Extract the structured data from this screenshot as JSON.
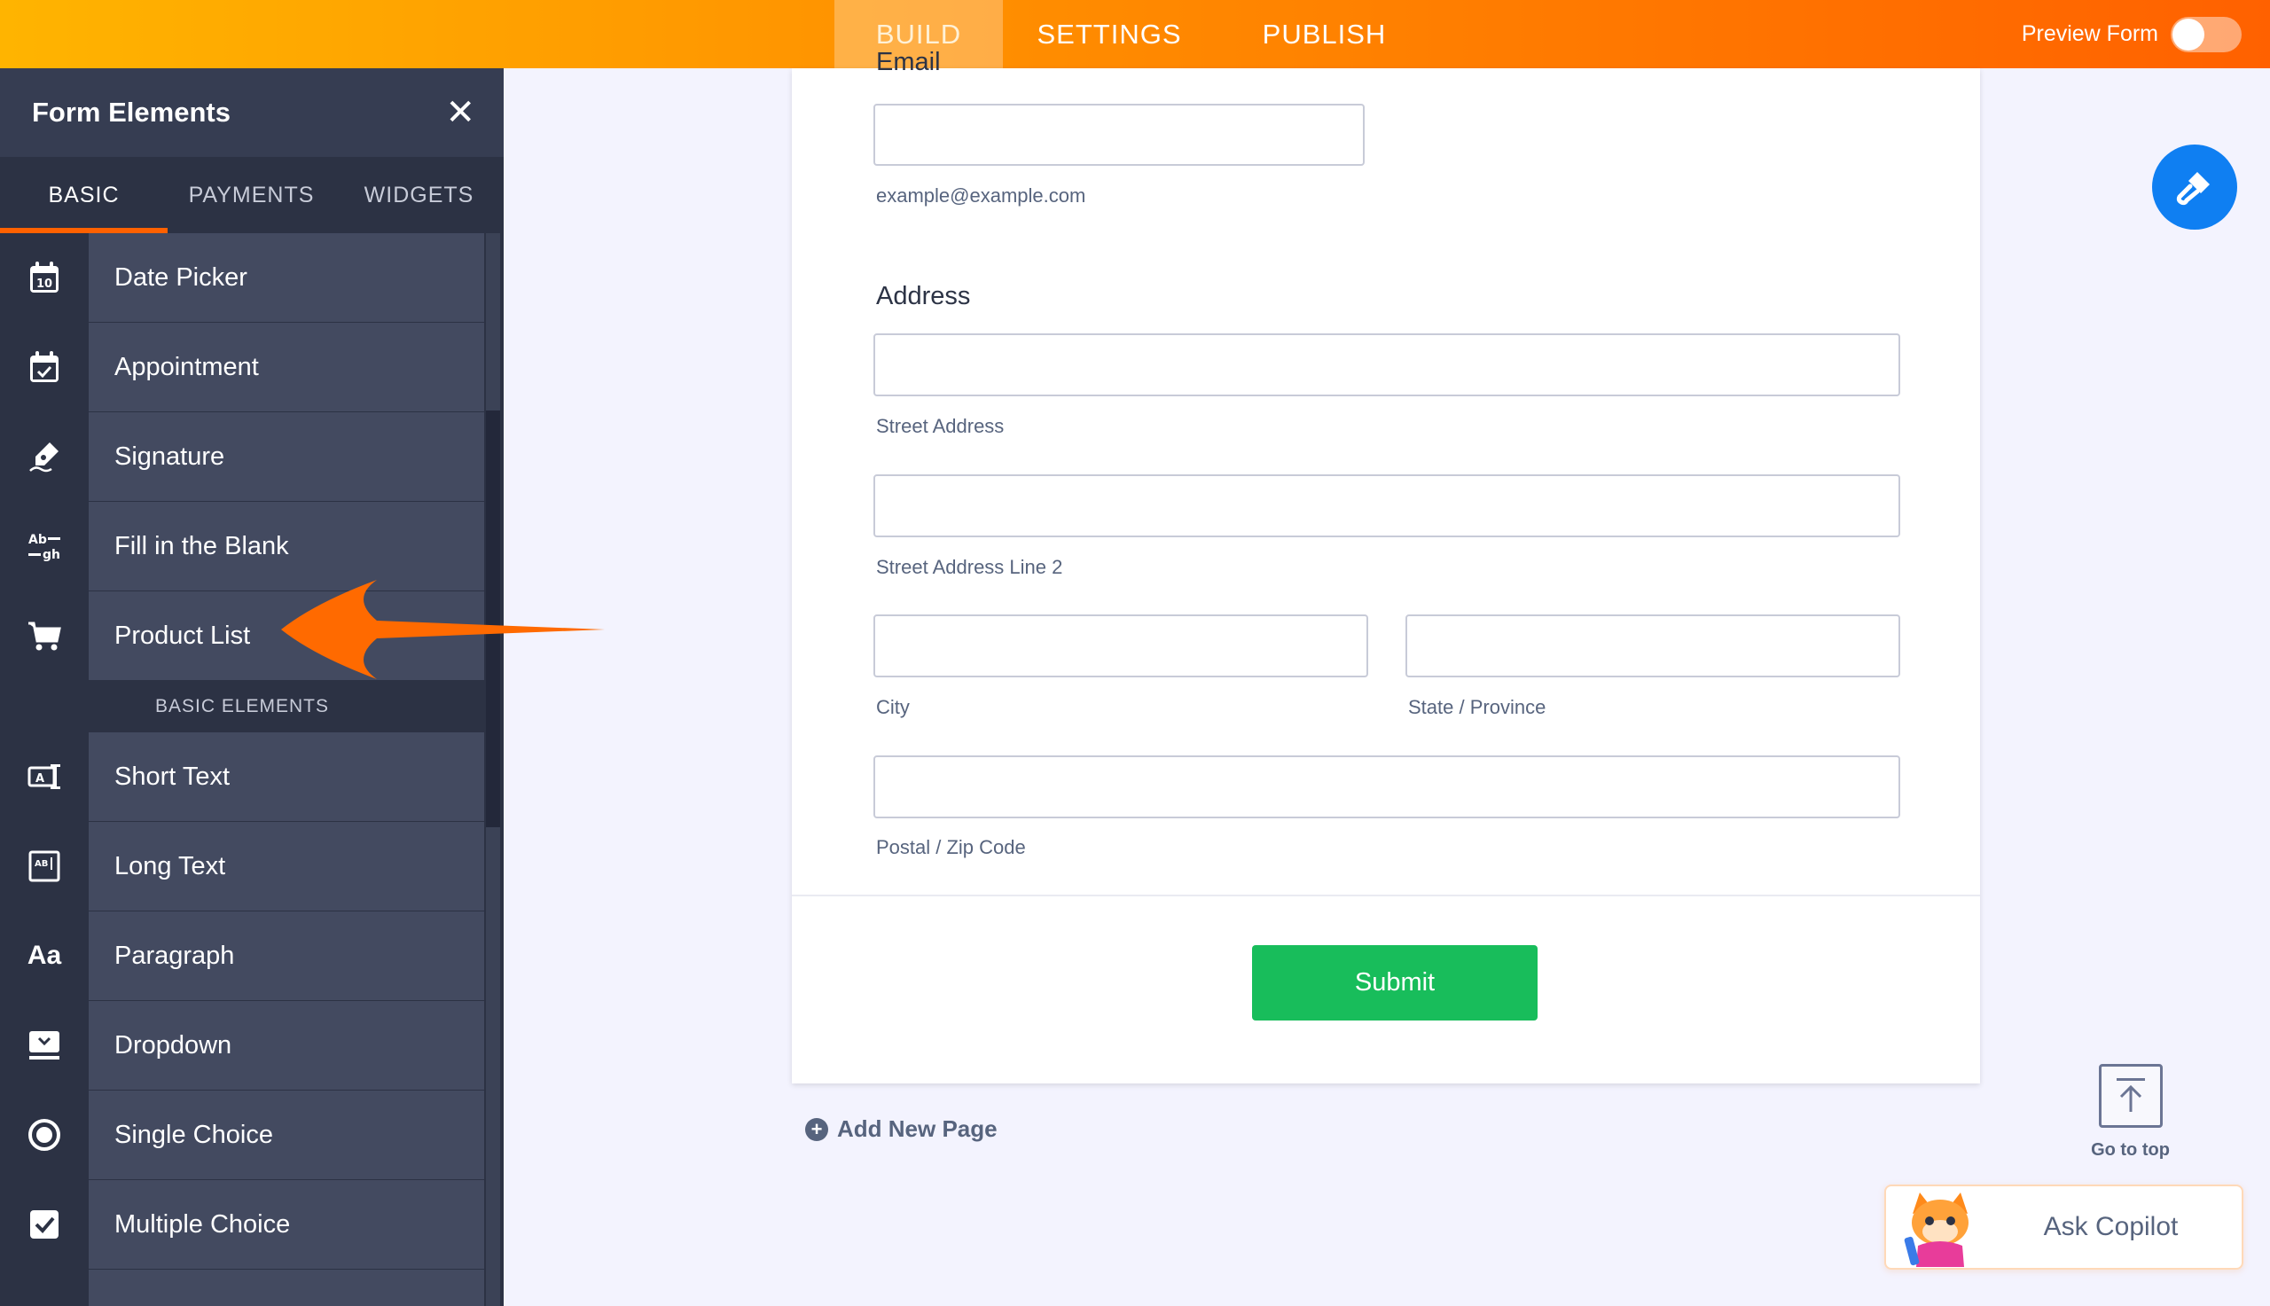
{
  "topbar": {
    "tabs": [
      {
        "label": "BUILD",
        "active": true
      },
      {
        "label": "SETTINGS",
        "active": false
      },
      {
        "label": "PUBLISH",
        "active": false
      }
    ],
    "preview_label": "Preview Form",
    "preview_enabled": false
  },
  "sidebar": {
    "title": "Form Elements",
    "tabs": [
      "BASIC",
      "PAYMENTS",
      "WIDGETS"
    ],
    "active_tab": "BASIC",
    "items_top": [
      {
        "label": "Date Picker",
        "icon": "calendar-icon"
      },
      {
        "label": "Appointment",
        "icon": "calendar-check-icon"
      },
      {
        "label": "Signature",
        "icon": "pen-icon"
      },
      {
        "label": "Fill in the Blank",
        "icon": "fill-blank-icon"
      },
      {
        "label": "Product List",
        "icon": "cart-icon"
      }
    ],
    "section_label": "BASIC ELEMENTS",
    "items_basic": [
      {
        "label": "Short Text",
        "icon": "short-text-icon"
      },
      {
        "label": "Long Text",
        "icon": "long-text-icon"
      },
      {
        "label": "Paragraph",
        "icon": "paragraph-icon"
      },
      {
        "label": "Dropdown",
        "icon": "dropdown-icon"
      },
      {
        "label": "Single Choice",
        "icon": "radio-icon"
      },
      {
        "label": "Multiple Choice",
        "icon": "checkbox-icon"
      }
    ],
    "paragraph_glyph": "Aa",
    "fill_blank_glyph_top": "Ab",
    "fill_blank_glyph_bottom": "gh"
  },
  "form": {
    "email_label": "Email",
    "email_sublabel": "example@example.com",
    "address_label": "Address",
    "street_sublabel": "Street Address",
    "street2_sublabel": "Street Address Line 2",
    "city_sublabel": "City",
    "state_sublabel": "State / Province",
    "postal_sublabel": "Postal / Zip Code",
    "submit_label": "Submit"
  },
  "add_page_label": "Add New Page",
  "go_to_top_label": "Go to top",
  "copilot_label": "Ask Copilot",
  "colors": {
    "accent": "#ff6100",
    "submit": "#18bd5b",
    "fab": "#0f7ff2",
    "sidebar": "#2c3244"
  }
}
